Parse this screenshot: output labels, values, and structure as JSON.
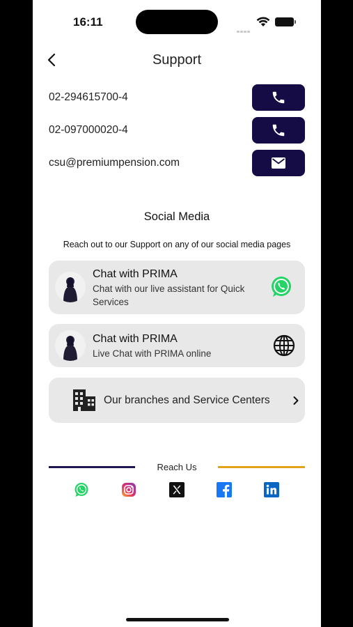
{
  "status_bar": {
    "time": "16:11"
  },
  "header": {
    "title": "Support"
  },
  "contacts": [
    {
      "text": "02-294615700-4",
      "action": "phone-icon"
    },
    {
      "text": "02-097000020-4",
      "action": "phone-icon"
    },
    {
      "text": "csu@premiumpension.com",
      "action": "mail-icon"
    }
  ],
  "social_section": {
    "title": "Social Media",
    "subtitle": "Reach out to our Support on any of our social media pages"
  },
  "cards": [
    {
      "title": "Chat with PRIMA",
      "description": "Chat with our live assistant for Quick Services",
      "icon": "whatsapp-icon"
    },
    {
      "title": "Chat with PRIMA",
      "description": "Live Chat with PRIMA  online",
      "icon": "globe-icon"
    }
  ],
  "branches": {
    "label": "Our branches and Service Centers"
  },
  "reach_us": {
    "label": "Reach Us"
  },
  "social_icons": [
    "whatsapp-icon",
    "instagram-icon",
    "x-icon",
    "facebook-icon",
    "linkedin-icon"
  ],
  "colors": {
    "button_navy": "#150c45",
    "card_bg": "#e8e8e8",
    "divider_left": "#1e1650",
    "divider_right": "#e3a21a",
    "whatsapp": "#25d366",
    "facebook": "#1877f2",
    "linkedin": "#0a66c2"
  }
}
